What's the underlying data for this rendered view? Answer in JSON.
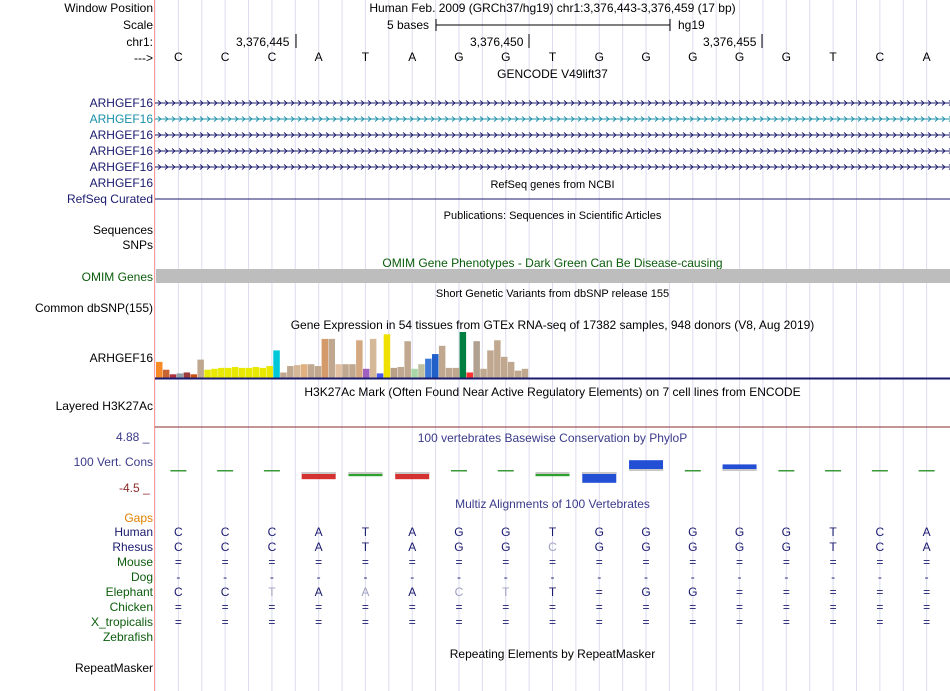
{
  "header": {
    "window_position_label": "Window Position",
    "window_position_value": "Human Feb. 2009 (GRCh37/hg19)   chr1:3,376,443-3,376,459 (17 bp)",
    "scale_label": "Scale",
    "scale_text": "5 bases",
    "scale_assembly": "hg19",
    "chrom_label": "chr1:",
    "arrow_label": "--->",
    "positions": [
      "3,376,445",
      "3,376,450",
      "3,376,455"
    ]
  },
  "sequence": [
    "C",
    "C",
    "C",
    "A",
    "T",
    "A",
    "G",
    "G",
    "T",
    "G",
    "G",
    "G",
    "G",
    "G",
    "T",
    "C",
    "A"
  ],
  "tracks": {
    "gencode": {
      "title": "GENCODE V49lift37",
      "genes": [
        "ARHGEF16",
        "ARHGEF16",
        "ARHGEF16",
        "ARHGEF16",
        "ARHGEF16",
        "ARHGEF16"
      ],
      "highlight_color": "#1a8fa8",
      "color": "#1a1a6e"
    },
    "refseq": {
      "title": "RefSeq genes from NCBI",
      "label": "RefSeq Curated",
      "color": "#1a1a6e"
    },
    "publications": {
      "title": "Publications: Sequences in Scientific Articles",
      "label1": "Sequences",
      "label2": "SNPs"
    },
    "omim": {
      "title": "OMIM Gene Phenotypes - Dark Green Can Be Disease-causing",
      "label": "OMIM Genes",
      "color": "#0b5c0b"
    },
    "dbsnp": {
      "title": "Short Genetic Variants from dbSNP release 155",
      "label": "Common dbSNP(155)"
    },
    "gtex": {
      "title": "Gene Expression in 54 tissues from GTEx RNA-seq of 17382 samples, 948 donors (V8, Aug 2019)",
      "label": "ARHGEF16",
      "bars": [
        0.35,
        0.18,
        0.08,
        0.1,
        0.12,
        0.08,
        0.4,
        0.18,
        0.2,
        0.22,
        0.22,
        0.24,
        0.22,
        0.22,
        0.24,
        0.22,
        0.26,
        0.6,
        0.12,
        0.26,
        0.28,
        0.3,
        0.3,
        0.26,
        0.85,
        0.85,
        0.3,
        0.3,
        0.3,
        0.82,
        0.2,
        0.85,
        0.1,
        0.95,
        0.22,
        0.24,
        0.8,
        0.2,
        0.3,
        0.42,
        0.52,
        0.7,
        0.22,
        0.22,
        1.0,
        0.12,
        0.8,
        0.2,
        0.6,
        0.82,
        0.46,
        0.35,
        0.16,
        0.2
      ],
      "colors": [
        "#f78a26",
        "#c86432",
        "#b0303e",
        "#8ea0a6",
        "#9c3a3a",
        "#c85014",
        "#c0a890",
        "#e8e800",
        "#e8e800",
        "#e8e800",
        "#e8e800",
        "#e8e800",
        "#e8e800",
        "#e8e800",
        "#e8e800",
        "#e8e800",
        "#e8e800",
        "#00c8d8",
        "#c0a890",
        "#c0a890",
        "#d4b898",
        "#e0b080",
        "#c0a890",
        "#c0a890",
        "#d49a6a",
        "#c0a890",
        "#e0c0a0",
        "#c0a890",
        "#c0a890",
        "#d4a880",
        "#a060c0",
        "#d4b898",
        "#4858e8",
        "#f0e000",
        "#b8a088",
        "#c0a890",
        "#c0a890",
        "#a8d8a8",
        "#c0c0a0",
        "#3c78d8",
        "#2060c8",
        "#c0a890",
        "#c0a890",
        "#c0a890",
        "#008040",
        "#ff3030",
        "#b0a090",
        "#c0a890",
        "#c0a890",
        "#c0a890",
        "#c0a890",
        "#c0a890",
        "#c0a890",
        "#c0a890"
      ]
    },
    "h3k27ac": {
      "title": "H3K27Ac Mark (Often Found Near Active Regulatory Elements) on 7 cell lines from ENCODE",
      "label": "Layered H3K27Ac",
      "color": "#8b2a2a"
    },
    "conservation": {
      "title": "100 vertebrates Basewise Conservation by PhyloP",
      "label": "100 Vert. Cons",
      "ymax": "4.88 _",
      "ymin": "-4.5 _",
      "color": "#3a3a8a",
      "min_color": "#8b2a2a",
      "values": [
        0.05,
        0.05,
        0.05,
        -0.6,
        -0.35,
        -0.6,
        0.1,
        0.1,
        -0.35,
        -0.9,
        0.9,
        0.1,
        0.55,
        0.05,
        0.05,
        0.05,
        0.05
      ]
    },
    "multiz": {
      "title": "Multiz Alignments of 100 Vertebrates",
      "gaps_label": "Gaps",
      "gaps_color": "#e08000",
      "species": [
        {
          "name": "Human",
          "color": "#1a1a6e",
          "bases": [
            "C",
            "C",
            "C",
            "A",
            "T",
            "A",
            "G",
            "G",
            "T",
            "G",
            "G",
            "G",
            "G",
            "G",
            "T",
            "C",
            "A"
          ]
        },
        {
          "name": "Rhesus",
          "color": "#1a1a6e",
          "bases": [
            "C",
            "C",
            "C",
            "A",
            "T",
            "A",
            "G",
            "G",
            "C",
            "G",
            "G",
            "G",
            "G",
            "G",
            "T",
            "C",
            "A"
          ]
        },
        {
          "name": "Mouse",
          "color": "#0b5c0b",
          "bases": [
            "=",
            "=",
            "=",
            "=",
            "=",
            "=",
            "=",
            "=",
            "=",
            "=",
            "=",
            "=",
            "=",
            "=",
            "=",
            "=",
            "="
          ]
        },
        {
          "name": "Dog",
          "color": "#0b5c0b",
          "bases": [
            "-",
            "-",
            "-",
            "-",
            "-",
            "-",
            "-",
            "-",
            "-",
            "-",
            "-",
            "-",
            "-",
            "-",
            "-",
            "-",
            "-"
          ]
        },
        {
          "name": "Elephant",
          "color": "#0b5c0b",
          "bases": [
            "C",
            "C",
            "T",
            "A",
            "A",
            "A",
            "C",
            "T",
            "T",
            "=",
            "G",
            "G",
            "=",
            "=",
            "=",
            "=",
            "="
          ]
        },
        {
          "name": "Chicken",
          "color": "#0b5c0b",
          "bases": [
            "=",
            "=",
            "=",
            "=",
            "=",
            "=",
            "=",
            "=",
            "=",
            "=",
            "=",
            "=",
            "=",
            "=",
            "=",
            "=",
            "="
          ]
        },
        {
          "name": "X_tropicalis",
          "color": "#0b5c0b",
          "bases": [
            "=",
            "=",
            "=",
            "=",
            "=",
            "=",
            "=",
            "=",
            "=",
            "=",
            "=",
            "=",
            "=",
            "=",
            "=",
            "=",
            "="
          ]
        },
        {
          "name": "Zebrafish",
          "color": "#0b5c0b",
          "bases": []
        }
      ]
    },
    "repeatmasker": {
      "title": "Repeating Elements by RepeatMasker",
      "label": "RepeatMasker"
    }
  }
}
